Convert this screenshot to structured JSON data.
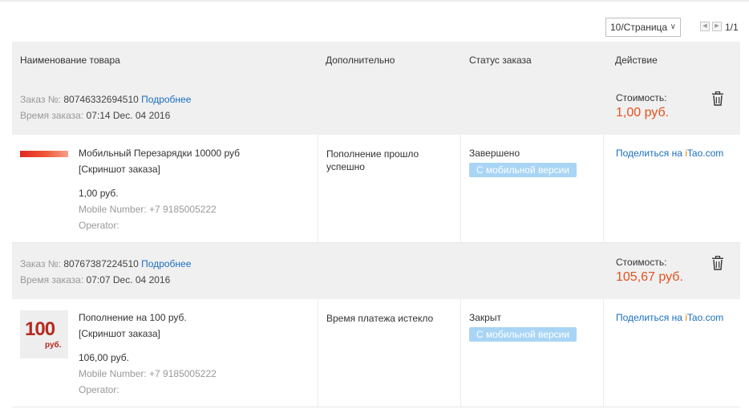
{
  "pagination": {
    "per_page": "10/Страница",
    "page_count": "1/1"
  },
  "table": {
    "columns": [
      "Наименование товара",
      "Дополнительно",
      "Статус заказа",
      "Действие"
    ]
  },
  "orders": [
    {
      "order_label": "Заказ №:",
      "order_number": "80746332694510",
      "details_link": "Подробнее",
      "time_label": "Время заказа:",
      "time_value": "07:14 Dec. 04 2016",
      "cost_label": "Стоимость:",
      "cost_value": "1,00 руб.",
      "product_title": "Мобильный Перезарядки 10000 руб",
      "screenshot_link": "[Скриншот заказа]",
      "price": "1,00 руб.",
      "mobile_number": "Mobile Number: +7 9185005222",
      "operator": "Operator:",
      "extra": "Пополнение прошло успешно",
      "status": "Завершено",
      "badge": "С мобильной версии",
      "share_prefix": "Поделиться на ",
      "share_i": "i",
      "share_rest": "Tao.com"
    },
    {
      "order_label": "Заказ №:",
      "order_number": "80767387224510",
      "details_link": "Подробнее",
      "time_label": "Время заказа:",
      "time_value": "07:07 Dec. 04 2016",
      "cost_label": "Стоимость:",
      "cost_value": "105,67 руб.",
      "product_title": "Пополнение на 100 руб.",
      "screenshot_link": "[Скриншот заказа]",
      "thumb_big": "100",
      "thumb_small": "руб.",
      "price": "106,00 руб.",
      "mobile_number": "Mobile Number: +7 9185005222",
      "operator": "Operator:",
      "extra": "Время платежа истекло",
      "status": "Закрыт",
      "badge": "С мобильной версии",
      "share_prefix": "Поделиться на ",
      "share_i": "i",
      "share_rest": "Tao.com"
    }
  ],
  "icons": {
    "trash": "trash-icon",
    "prev": "chevron-left-icon",
    "next": "chevron-right-icon",
    "dropdown": "chevron-down-icon"
  },
  "colors": {
    "price_accent": "#e5511d",
    "link": "#1a6ec1",
    "badge": "#a9d5f5",
    "header_bg": "#f0f0f0"
  }
}
